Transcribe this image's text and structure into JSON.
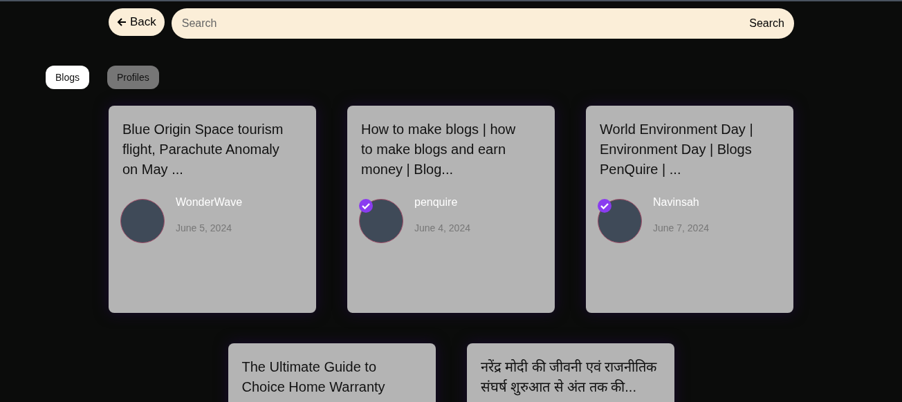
{
  "back_button": {
    "label": "Back"
  },
  "search": {
    "placeholder": "Search",
    "button": "Search"
  },
  "tabs": [
    {
      "label": "Blogs",
      "selected": true
    },
    {
      "label": "Profiles",
      "selected": false
    }
  ],
  "posts": [
    {
      "title": "Blue Origin Space tourism flight, Parachute Anomaly on May ...",
      "author": "WonderWave",
      "date": "June 5, 2024",
      "verified": false
    },
    {
      "title": "How to make blogs | how to make blogs and earn money | Blog...",
      "author": "penquire",
      "date": "June 4, 2024",
      "verified": true
    },
    {
      "title": "World Environment Day | Environment Day | Blogs PenQuire | ...",
      "author": "Navinsah",
      "date": "June 7, 2024",
      "verified": true
    },
    {
      "title": "The Ultimate Guide to Choice Home Warranty"
    },
    {
      "title": "नरेंद्र मोदी की जीवनी एवं राजनीतिक संघर्ष शुरुआत से अंत तक की..."
    }
  ]
}
